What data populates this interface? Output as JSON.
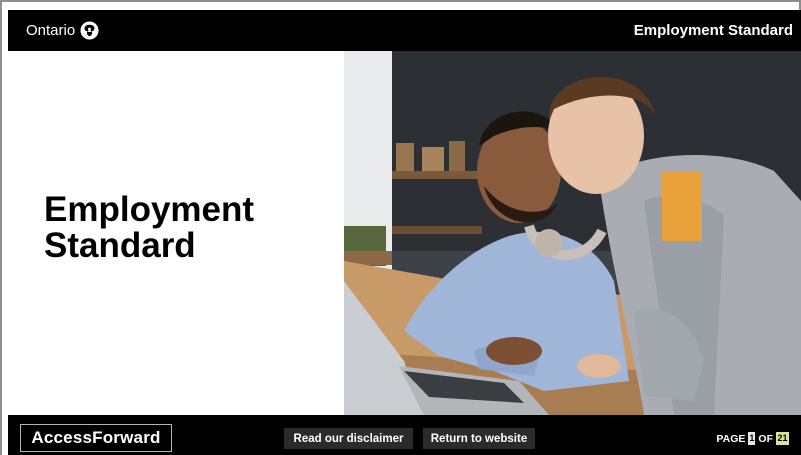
{
  "header": {
    "brand_name": "Ontario",
    "course_title": "Employment Standard"
  },
  "slide": {
    "heading_line1": "Employment",
    "heading_line2": "Standard",
    "image_description": "photo-two-men-at-laptop"
  },
  "footer": {
    "logo_text": "AccessForward",
    "disclaimer_label": "Read our disclaimer",
    "return_label": "Return to website",
    "page_label": "PAGE",
    "page_current": "1",
    "of_label": "OF",
    "page_total": "21"
  },
  "colors": {
    "bar_background": "#000000",
    "button_background": "#2b2b2b",
    "page_total_accent": "#d6e59a"
  }
}
